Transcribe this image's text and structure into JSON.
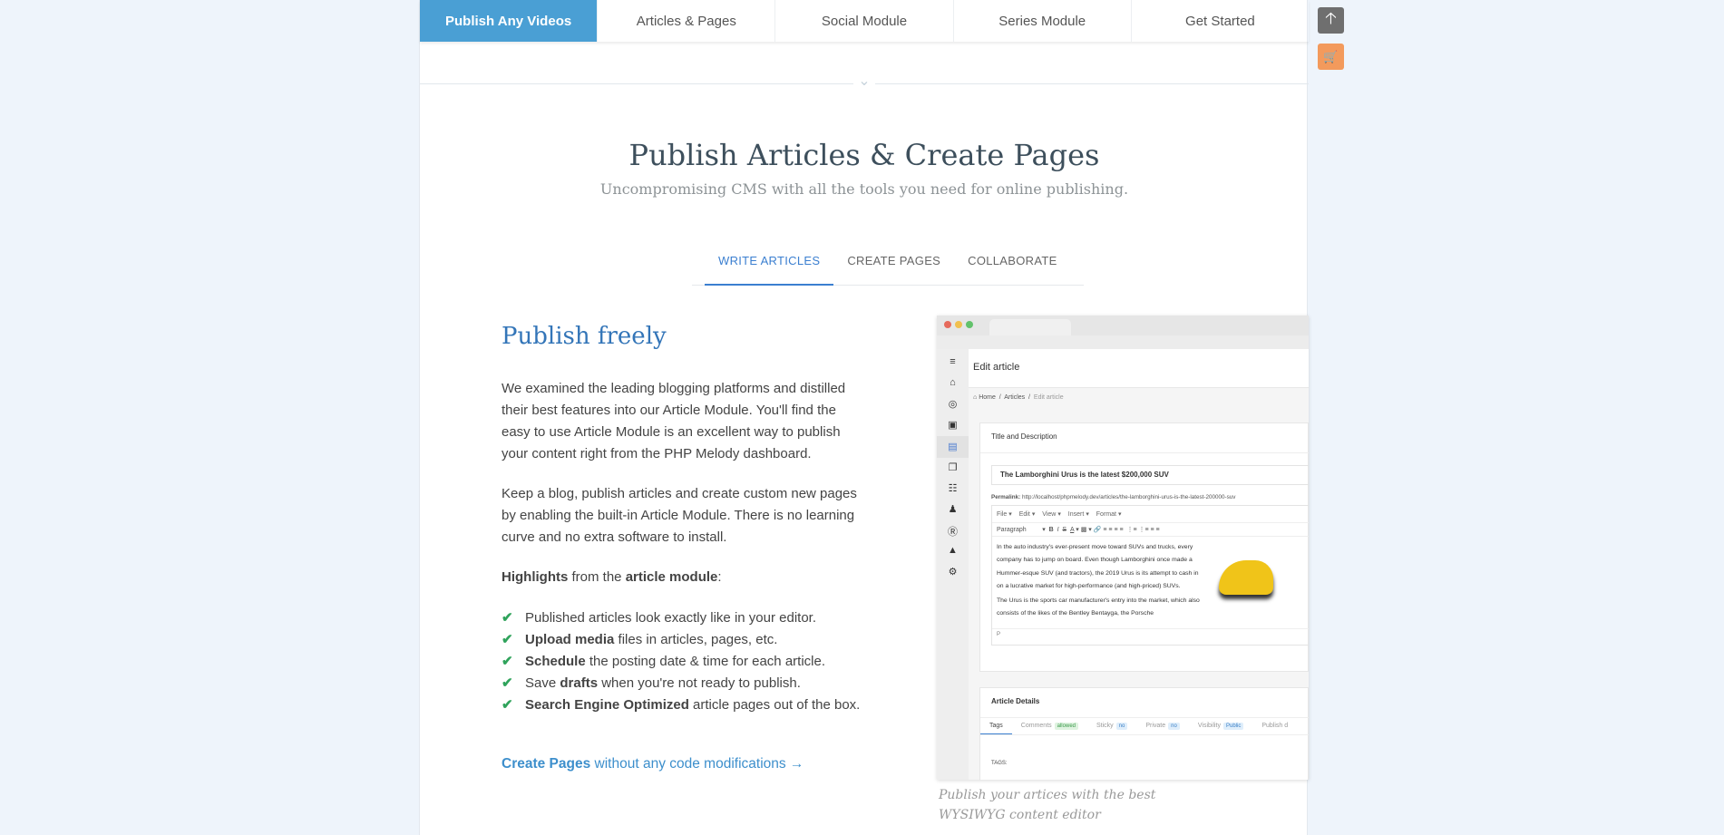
{
  "nav": {
    "tabs": [
      {
        "label": "Publish Any Videos",
        "active": true
      },
      {
        "label": "Articles & Pages"
      },
      {
        "label": "Social Module"
      },
      {
        "label": "Series Module"
      },
      {
        "label": "Get Started"
      }
    ]
  },
  "side_buttons": {
    "up": "arrow-up-icon",
    "cart": "cart-icon",
    "up_color": "#6f6f6f",
    "cart_color": "#f39a5c"
  },
  "section": {
    "title": "Publish Articles & Create Pages",
    "subtitle": "Uncompromising CMS with all the tools you need for online publishing."
  },
  "subtabs": [
    {
      "label": "WRITE ARTICLES",
      "active": true
    },
    {
      "label": "CREATE PAGES"
    },
    {
      "label": "COLLABORATE"
    }
  ],
  "content": {
    "heading": "Publish freely",
    "p1": "We examined the leading blogging platforms and distilled their best features into our Article Module. You'll find the easy to use Article Module is an excellent way to publish your content right from the PHP Melody dashboard.",
    "p2": "Keep a blog, publish articles and create custom new pages by enabling the built-in Article Module. There is no learning curve and no extra software to install.",
    "hl_b1": "Highlights",
    "hl_mid": " from the ",
    "hl_b2": "article module",
    "hl_end": ":",
    "items": [
      {
        "pre": "",
        "bold": "",
        "rest": "Published articles look exactly like in your editor."
      },
      {
        "pre": "",
        "bold": "Upload media",
        "rest": " files in articles, pages, etc."
      },
      {
        "pre": "",
        "bold": "Schedule",
        "rest": " the posting date & time for each article."
      },
      {
        "pre": "Save ",
        "bold": "drafts",
        "rest": " when you're not ready to publish."
      },
      {
        "pre": "",
        "bold": "Search Engine Optimized",
        "rest": " article pages out of the box."
      }
    ],
    "link_bold": "Create Pages",
    "link_rest": " without any code modifications →"
  },
  "mockup": {
    "header": "Edit article",
    "breadcrumb": [
      "Home",
      "Articles",
      "Edit article"
    ],
    "card1_title": "Title and Description",
    "title_value": "The Lamborghini Urus is the latest $200,000 SUV",
    "permalink_label": "Permalink:",
    "permalink": "http://localhost/phpmelody.dev/articles/the-lamborghini-urus-is-the-latest-200000-suv",
    "menus": [
      "File",
      "Edit",
      "View",
      "Insert",
      "Format"
    ],
    "format_select": "Paragraph",
    "body1": "In the auto industry's ever-present move toward SUVs and trucks, every company has to jump on board. Even though Lamborghini once made a Hummer-esque SUV (and tractors), the 2019 Urus is its attempt to cash in on a lucrative market for high-performance (and high-priced) SUVs.",
    "body2": "The Urus is the sports car manufacturer's entry into the market, which also consists of the likes of the Bentley Bentayga, the Porsche",
    "path": "P",
    "card2_title": "Article Details",
    "tabs": [
      {
        "label": "Tags"
      },
      {
        "label": "Comments",
        "badge": "allowed"
      },
      {
        "label": "Sticky",
        "badge": "no"
      },
      {
        "label": "Private",
        "badge": "no"
      },
      {
        "label": "Visibility",
        "badge": "Public"
      },
      {
        "label": "Publish d"
      }
    ],
    "tags_label": "TAGS:"
  },
  "caption": "Publish your artices with the best WYSIWYG content editor"
}
